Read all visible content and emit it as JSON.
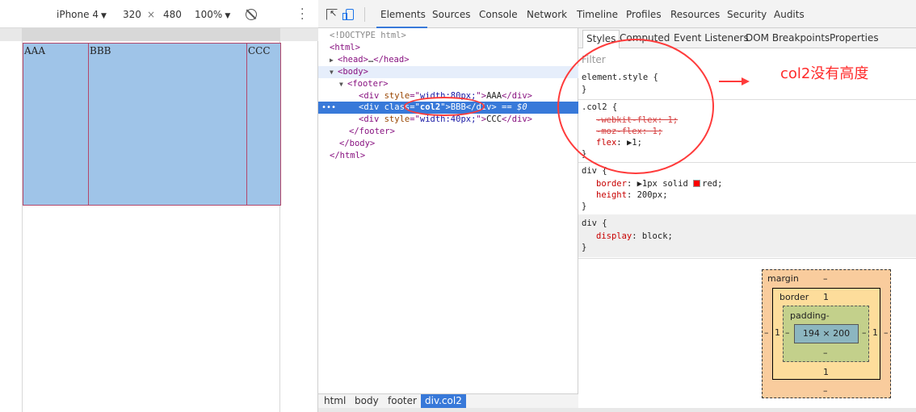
{
  "device_toolbar": {
    "device": "iPhone 4",
    "width": "320",
    "times": "×",
    "height": "480",
    "zoom": "100%"
  },
  "page_columns": [
    "AAA",
    "BBB",
    "CCC"
  ],
  "main_tabs": [
    "Elements",
    "Sources",
    "Console",
    "Network",
    "Timeline",
    "Profiles",
    "Resources",
    "Security",
    "Audits"
  ],
  "dom": {
    "doctype": "<!DOCTYPE html>",
    "html_open": "<html>",
    "head_open": "<head>",
    "head_ellipsis": "…",
    "head_close": "</head>",
    "body_open": "<body>",
    "footer_open": "<footer>",
    "div1_open": "<div ",
    "div1_attr": "style",
    "div1_eq": "=\"",
    "div1_val": "width:80px;",
    "div1_q": "\">",
    "div1_text": "AAA",
    "div1_close": "</div>",
    "div2_open": "<div ",
    "div2_attr": "class",
    "div2_eq": "=\"",
    "div2_val": "col2",
    "div2_q": "\">",
    "div2_text": "BBB",
    "div2_close": "</div>",
    "div2_suffix": " == $0",
    "div3_open": "<div ",
    "div3_attr": "style",
    "div3_eq": "=\"",
    "div3_val": "width:40px;",
    "div3_q": "\">",
    "div3_text": "CCC",
    "div3_close": "</div>",
    "footer_close": "</footer>",
    "body_close": "</body>",
    "html_close": "</html>"
  },
  "breadcrumbs": [
    "html",
    "body",
    "footer",
    "div.col2"
  ],
  "sub_tabs": [
    "Styles",
    "Computed",
    "Event Listeners",
    "DOM Breakpoints",
    "Properties"
  ],
  "styles": {
    "filter_placeholder": "Filter",
    "element_style_selector": "element.style {",
    "close_brace": "}",
    "col2_selector": ".col2 {",
    "col2_webkit": "-webkit-flex: 1;",
    "col2_moz": "-moz-flex: 1;",
    "col2_flex_name": "flex",
    "col2_flex_val": ": ▶1;",
    "div_selector": "div {",
    "border_name": "border",
    "border_val": ": ▶1px solid ",
    "border_color": "red;",
    "height_name": "height",
    "height_val": ": 200px;",
    "ua_selector": "div {",
    "display_name": "display",
    "display_val": ": block;"
  },
  "annotation": "col2没有高度",
  "box_model": {
    "margin_label": "margin",
    "margin_top": "–",
    "margin_bottom": "–",
    "margin_left": "–",
    "margin_right": "–",
    "border_label": "border",
    "border_top": "1",
    "border_bottom": "1",
    "border_left": "1",
    "border_right": "1",
    "padding_label": "padding-",
    "padding_bottom": "–",
    "padding_left": "–",
    "padding_right": "–",
    "content": "194 × 200"
  },
  "colors": {
    "accent": "#3879d9",
    "annotation": "#ff2a2a",
    "column_fill": "#9fc4e8",
    "column_border": "#b3476b"
  }
}
